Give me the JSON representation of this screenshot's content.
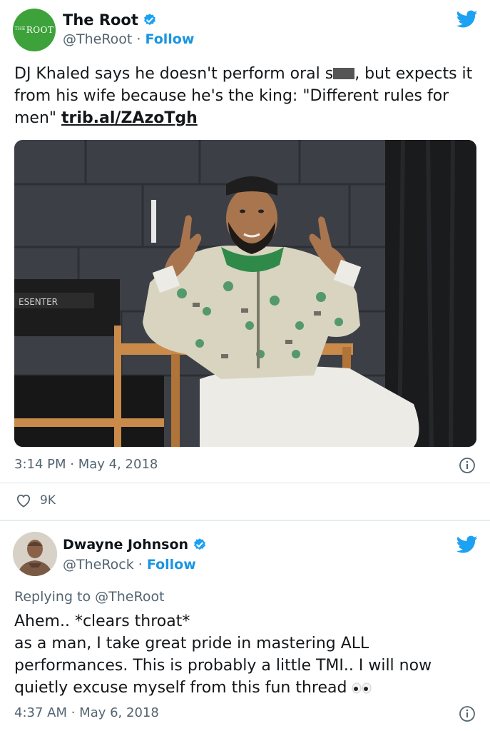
{
  "tweet1": {
    "avatar_text": "THE ROOT",
    "name": "The Root",
    "handle": "@TheRoot",
    "separator": " · ",
    "follow_label": "Follow",
    "text_part1": "DJ Khaled says he doesn't perform oral s",
    "text_part2": ", but expects it from his wife because he's the king: \"Different rules for men\" ",
    "link": "trib.al/ZAzoTgh",
    "chair_text": "ESENTER",
    "time": "3:14 PM",
    "date": "May 4, 2018",
    "likes": "9K"
  },
  "tweet2": {
    "name": "Dwayne Johnson",
    "handle": "@TheRock",
    "separator": " · ",
    "follow_label": "Follow",
    "replying_to": "Replying to @TheRoot",
    "text": "Ahem.. *clears throat*\nas a man, I take great pride in mastering ALL performances. This is probably a little TMI.. I will now quietly excuse myself from this fun thread",
    "time": "4:37 AM",
    "date": "May 6, 2018"
  },
  "colors": {
    "twitter_blue": "#1da1f2",
    "follow_blue": "#1b95e0",
    "root_green": "#3da23a",
    "muted_gray": "#536471"
  },
  "icons": [
    "verified-badge-icon",
    "twitter-bird-icon",
    "info-icon",
    "heart-icon",
    "eyes-emoji-icon"
  ]
}
